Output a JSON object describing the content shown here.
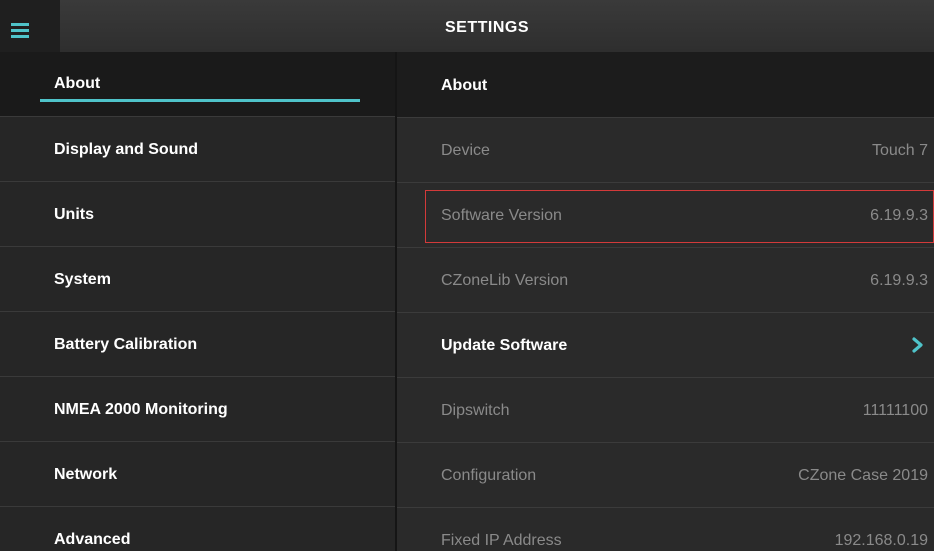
{
  "header": {
    "title": "SETTINGS",
    "menu_icon": "hamburger-menu-icon",
    "accent_color": "#4fc3c9"
  },
  "sidebar": {
    "items": [
      {
        "label": "About",
        "selected": true
      },
      {
        "label": "Display and Sound"
      },
      {
        "label": "Units"
      },
      {
        "label": "System"
      },
      {
        "label": "Battery Calibration"
      },
      {
        "label": "NMEA 2000 Monitoring"
      },
      {
        "label": "Network"
      },
      {
        "label": "Advanced"
      }
    ]
  },
  "about": {
    "heading": "About",
    "rows": [
      {
        "label": "Device",
        "value": "Touch 7"
      },
      {
        "label": "Software Version",
        "value": "6.19.9.3",
        "highlighted": true
      },
      {
        "label": "CZoneLib Version",
        "value": "6.19.9.3"
      },
      {
        "label": "Update Software",
        "icon": "chevron-right-icon",
        "active": true
      },
      {
        "label": "Dipswitch",
        "value": "11111100"
      },
      {
        "label": "Configuration",
        "value": "CZone Case 2019"
      },
      {
        "label": "Fixed IP Address",
        "value": "192.168.0.19"
      }
    ],
    "highlight_color": "#d33a3a"
  }
}
